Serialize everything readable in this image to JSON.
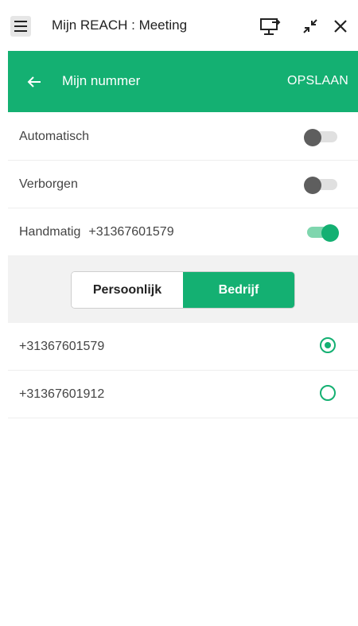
{
  "titlebar": {
    "menu_icon": "hamburger-menu-icon",
    "title": "Mijn REACH : Meeting",
    "screen_share_icon": "screen-share-icon",
    "minimize_icon": "collapse-arrows-icon",
    "close_icon": "close-icon"
  },
  "header": {
    "back_icon": "arrow-left-icon",
    "title": "Mijn nummer",
    "save_label": "OPSLAAN"
  },
  "settings": [
    {
      "label": "Automatisch",
      "value": "",
      "toggle_on": false
    },
    {
      "label": "Verborgen",
      "value": "",
      "toggle_on": false
    },
    {
      "label": "Handmatig",
      "value": "+31367601579",
      "toggle_on": true
    }
  ],
  "segment": {
    "options": [
      "Persoonlijk",
      "Bedrijf"
    ],
    "selected": "Bedrijf"
  },
  "numbers": [
    {
      "number": "+31367601579",
      "selected": true
    },
    {
      "number": "+31367601912",
      "selected": false
    }
  ],
  "colors": {
    "accent": "#14b072",
    "toggle_off_knob": "#5e5e5e",
    "segment_background": "#f2f2f2"
  }
}
